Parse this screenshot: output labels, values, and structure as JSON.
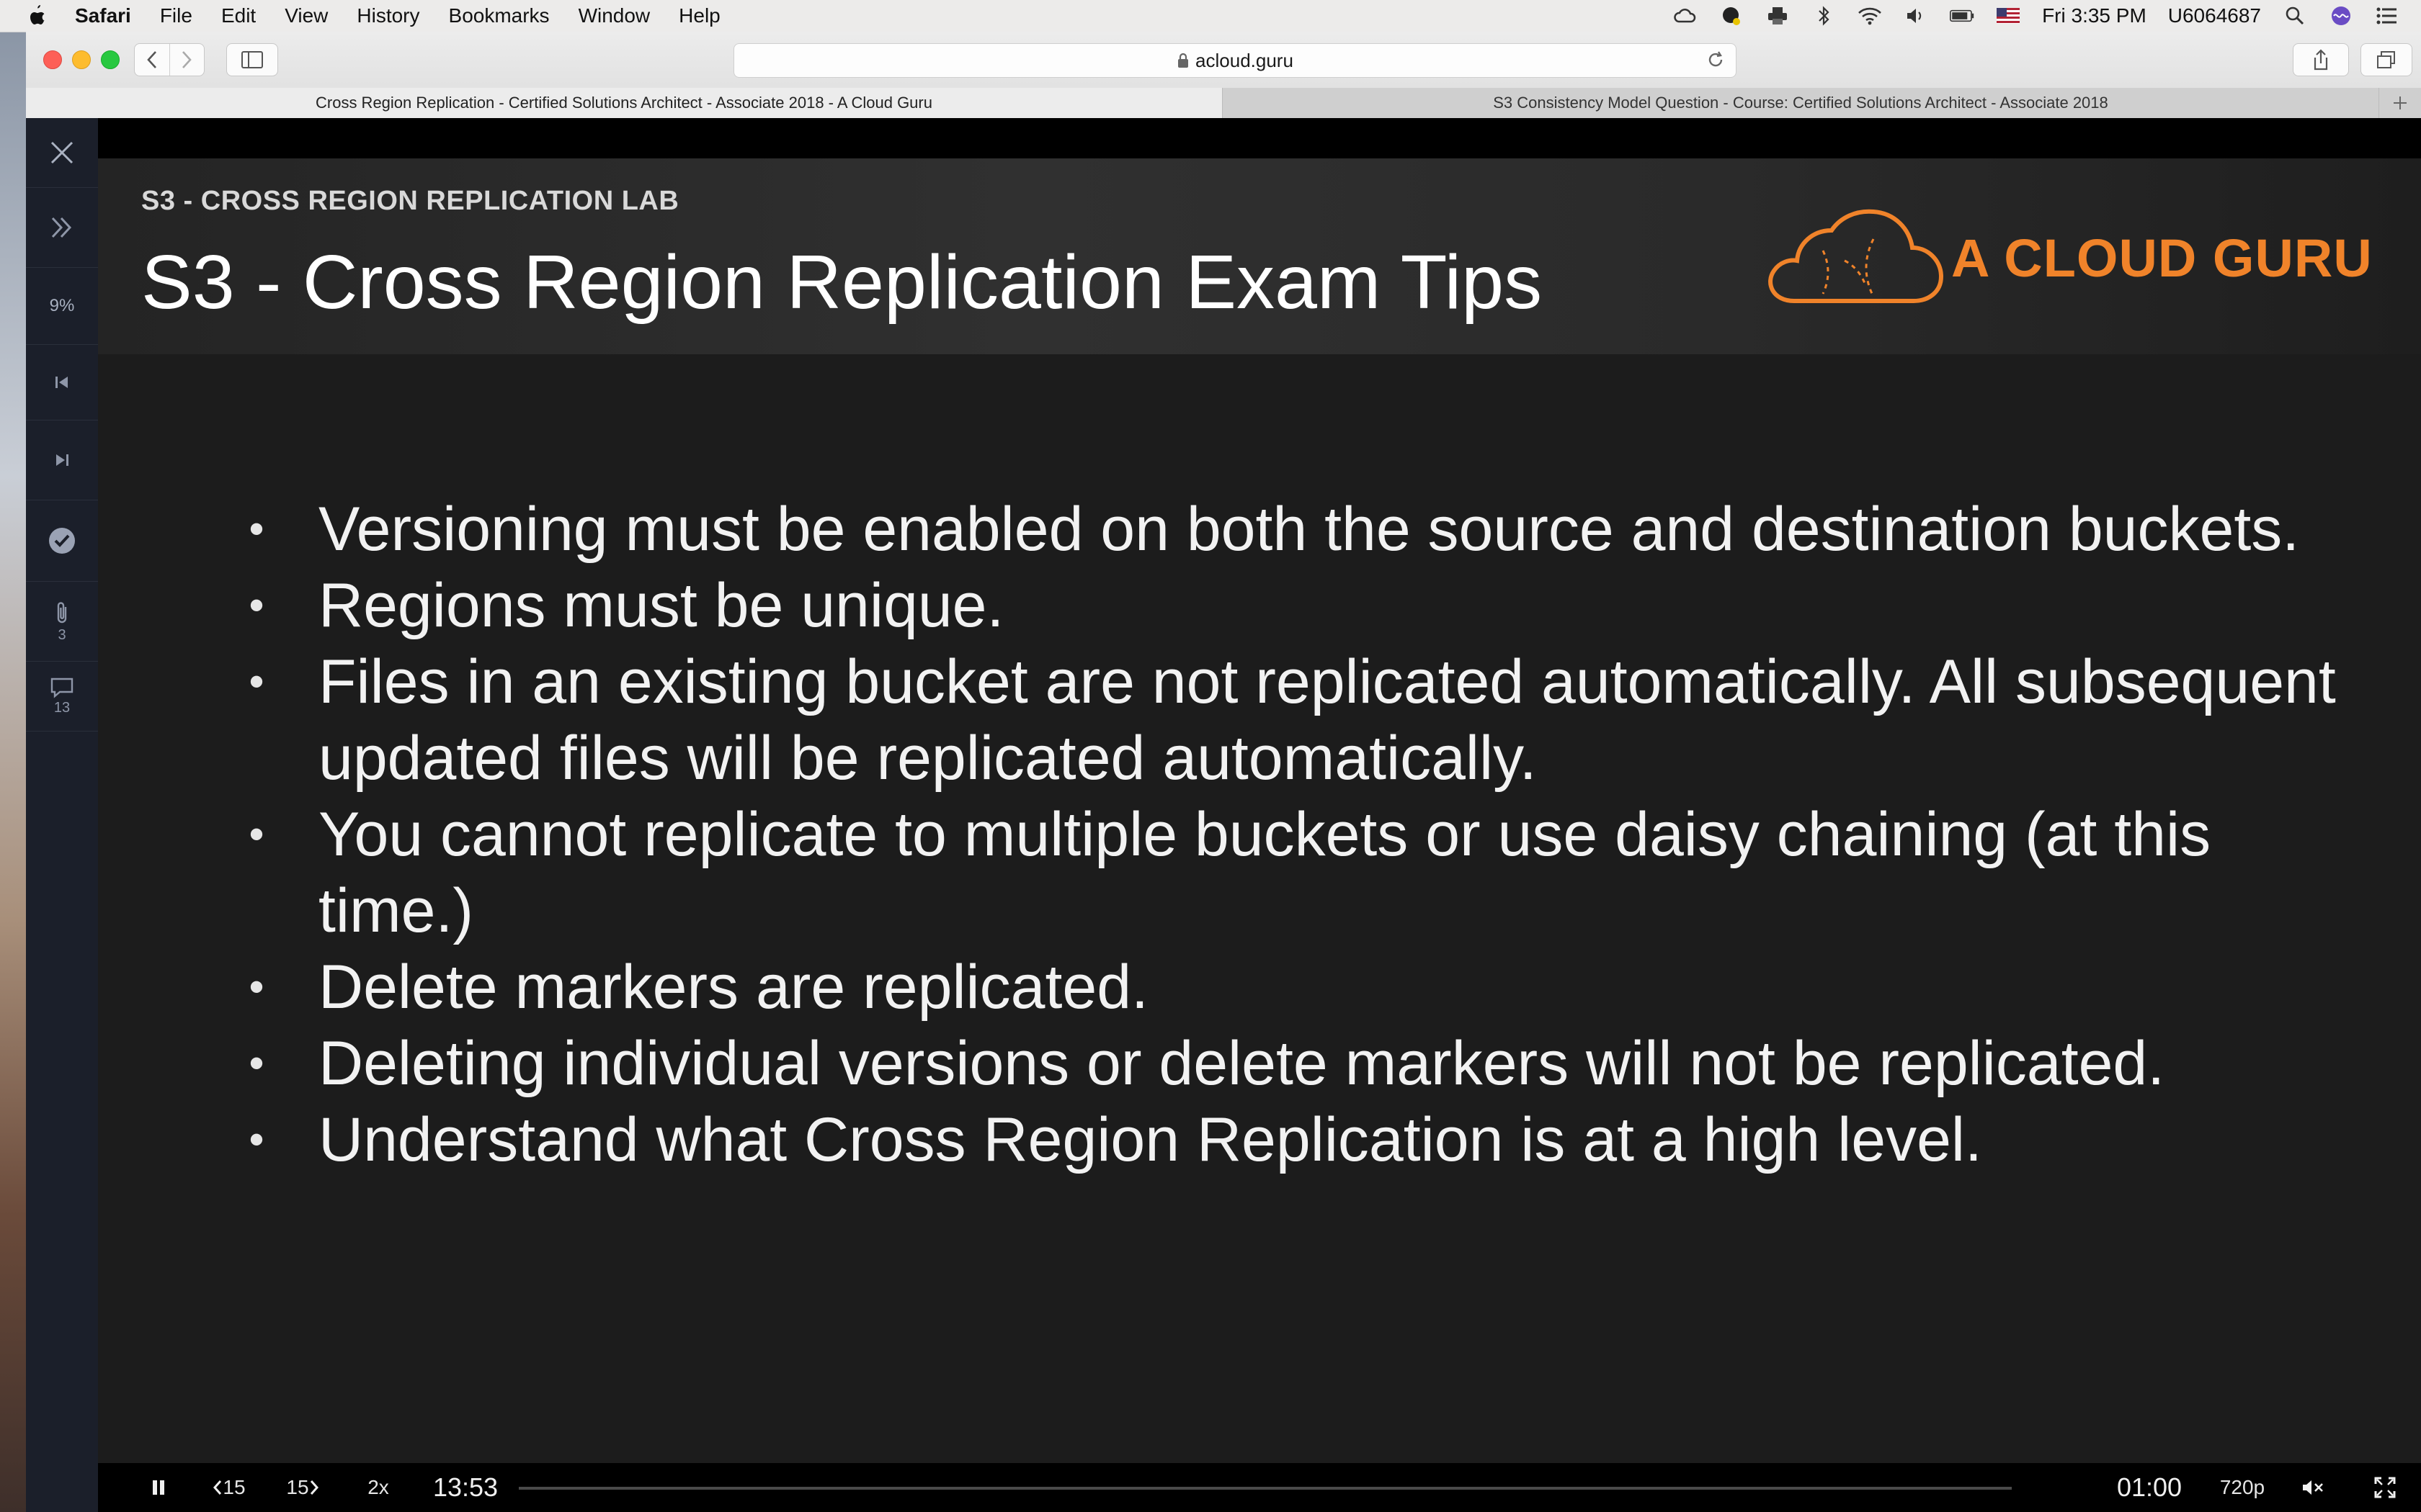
{
  "menubar": {
    "app_name": "Safari",
    "items": [
      "File",
      "Edit",
      "View",
      "History",
      "Bookmarks",
      "Window",
      "Help"
    ],
    "clock": "Fri 3:35 PM",
    "user": "U6064687"
  },
  "browser": {
    "url": "acloud.guru",
    "tabs": [
      {
        "label": "Cross Region Replication - Certified Solutions Architect - Associate 2018 - A Cloud Guru",
        "active": true
      },
      {
        "label": "S3 Consistency Model Question - Course: Certified Solutions Architect - Associate 2018",
        "active": false
      }
    ]
  },
  "sidebar": {
    "progress": "9%",
    "attachments_count": "3",
    "comments_count": "13"
  },
  "slide": {
    "kicker": "S3 - CROSS REGION REPLICATION LAB",
    "title": "S3 - Cross Region Replication Exam Tips",
    "logo_text": "A CLOUD GURU",
    "bullet_symbol": "•",
    "bullets": [
      "Versioning must be enabled on both the source and destination buckets.",
      "Regions must be unique.",
      "Files in an existing bucket are not replicated automatically. All subsequent updated files will be replicated automatically.",
      "You cannot replicate to multiple buckets or use daisy chaining (at this time.)",
      "Delete markers are replicated.",
      "Deleting individual versions or delete markers will not be replicated.",
      "Understand what Cross Region Replication is at a high level."
    ]
  },
  "player": {
    "rewind_label": "15",
    "forward_label": "15",
    "speed": "2x",
    "remaining_time": "13:53",
    "elapsed_time": "01:00",
    "quality": "720p",
    "progress_fraction": 0.0
  },
  "colors": {
    "accent_logo": "#f0832a",
    "slide_bg": "#1c1c1c",
    "rail_bg": "#1b1f2a"
  }
}
